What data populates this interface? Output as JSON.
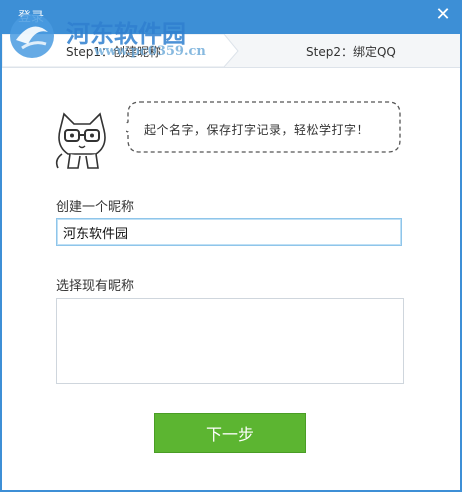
{
  "window": {
    "title": "登录",
    "close_glyph": "✕"
  },
  "steps": {
    "step1": "Step1：创建昵称",
    "step2": "Step2：绑定QQ",
    "active_color": "#ffffff",
    "bar_color": "#f4f6f8"
  },
  "watermark": {
    "site_name": "河东软件园",
    "url": "www.pc0359.cn"
  },
  "tip": {
    "text": "起个名字，保存打字记录，轻松学打字！"
  },
  "form": {
    "create_label": "创建一个昵称",
    "nickname_value": "河东软件园",
    "existing_label": "选择现有昵称",
    "existing_items": []
  },
  "actions": {
    "next_label": "下一步"
  },
  "colors": {
    "accent": "#3d8fd6",
    "button": "#5cb531",
    "input_focus": "#8fc5ea"
  }
}
